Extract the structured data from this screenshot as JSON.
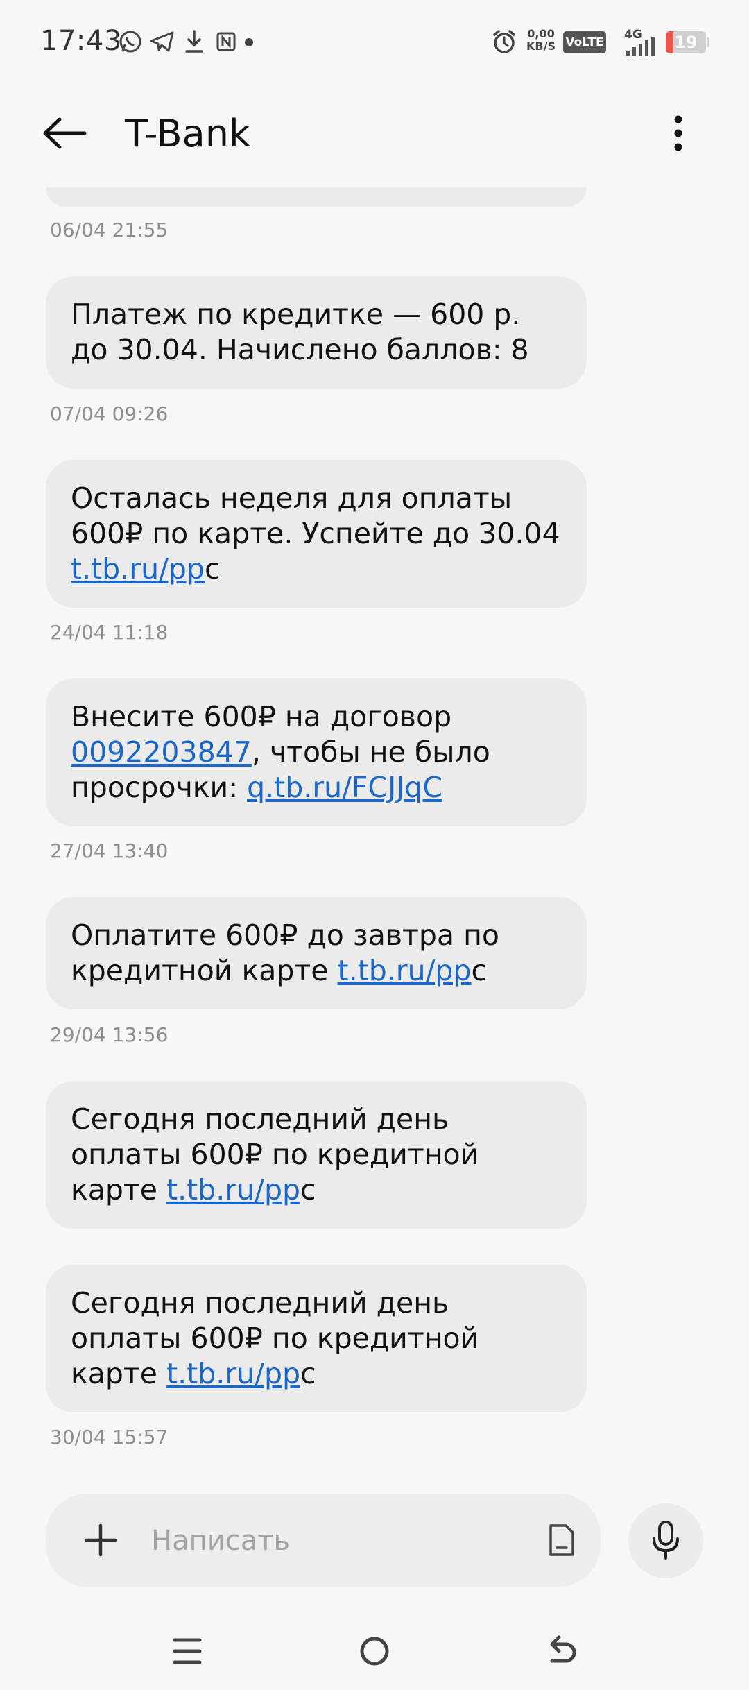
{
  "status_bar": {
    "time": "17:43",
    "speed_value": "0,00",
    "speed_unit": "KB/S",
    "volte": "VoLTE",
    "network": "4G",
    "battery_level": "19",
    "battery_fraction": 0.19,
    "battery_color": "#e8574f",
    "icons": [
      "whatsapp-icon",
      "telegram-icon",
      "download-icon",
      "nfc-icon",
      "alarm-icon",
      "signal-icon"
    ]
  },
  "header": {
    "title": "T-Bank"
  },
  "colors": {
    "link": "#1a66c9",
    "bubble": "#ebebeb",
    "background": "#f7f7f7"
  },
  "messages": [
    {
      "id": "m0",
      "partial": true,
      "timestamp": "06/04 21:55"
    },
    {
      "id": "m1",
      "text": "Платеж по кредитке — 600 р. до 30.04. Начислено баллов: 8",
      "timestamp": "07/04 09:26"
    },
    {
      "id": "m2",
      "text_before": "Осталась неделя для оплаты 600₽ по карте. Успейте до 30.04",
      "link": "t.tb.ru/pp",
      "link_tail": "c",
      "timestamp": "24/04 11:18"
    },
    {
      "id": "m3",
      "text_before": "Внесите 600₽ на договор",
      "contract_link": "0092203847",
      "text_middle": ", чтобы не было просрочки:",
      "link": "q.tb.ru/FCJJqC",
      "timestamp": "27/04 13:40"
    },
    {
      "id": "m4",
      "text_before": "Оплатите 600₽ до завтра по кредитной карте",
      "link": "t.tb.ru/pp",
      "link_tail": "c",
      "timestamp": "29/04 13:56"
    },
    {
      "id": "m5",
      "text_before": "Сегодня последний день оплаты 600₽ по кредитной карте",
      "link": "t.tb.ru/pp",
      "link_tail": "c"
    },
    {
      "id": "m6",
      "text_before": "Сегодня последний день оплаты 600₽ по кредитной карте",
      "link": "t.tb.ru/pp",
      "link_tail": "c",
      "timestamp": "30/04 15:57"
    }
  ],
  "composer": {
    "placeholder": "Написать",
    "value": ""
  }
}
